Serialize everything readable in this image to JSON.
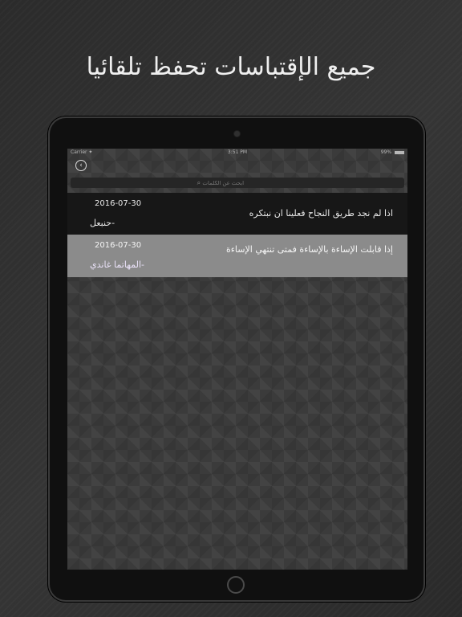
{
  "headline": "جميع الإقتباسات تحفظ تلقائيا",
  "statusbar": {
    "carrier": "Carrier ✦",
    "time": "3:51 PM",
    "battery": "99%"
  },
  "search": {
    "placeholder": "ابحث عن الكلمات"
  },
  "quotes": [
    {
      "date": "2016-07-30",
      "author": "-حنبعل",
      "text": "اذا لم نجد طريق النجاح فعلينا ان نبتكره"
    },
    {
      "date": "2016-07-30",
      "author": "-المهاتما غاندي",
      "text": "إذا قابلت الإساءة بالإساءة فمتى تنتهي الإساءة"
    }
  ]
}
